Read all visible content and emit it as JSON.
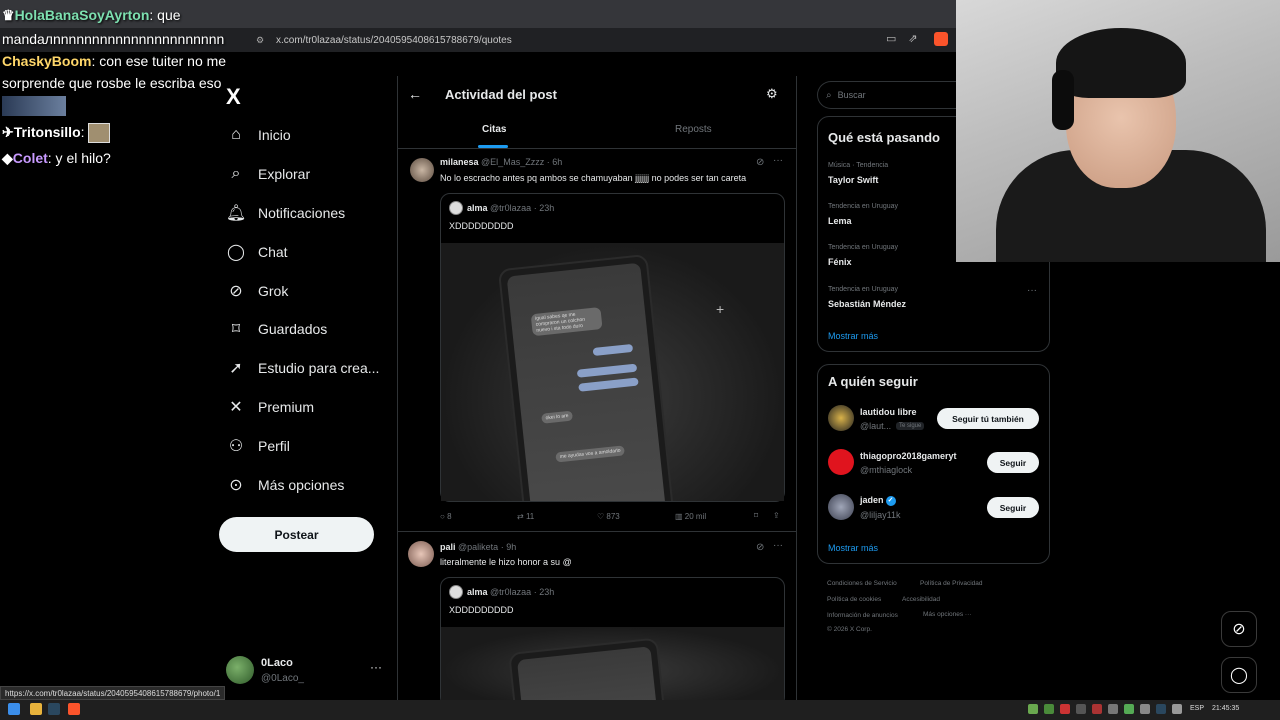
{
  "browser": {
    "url": "x.com/tr0lazaa/status/2040595408615788679/quotes",
    "status_url": "https://x.com/tr0lazaa/status/2040595408615788679/photo/1"
  },
  "chat": {
    "line1_name": "HolaBanaSoyAyrton",
    "line1_msg": ": que",
    "line2_msg": "mandaлnnnnnnnnnnnnnnnnnnnnnn",
    "line3_name": "ChaskyBoom",
    "line3_msg": ": con ese tuiter no me",
    "line4_msg": "sorprende que rosbe le escriba eso",
    "line5_name": "Tritonsillo",
    "line5_msg": ":",
    "line6_name": "Colet",
    "line6_msg": ": y el hilo?"
  },
  "nav": {
    "logo": "X",
    "items": [
      {
        "label": "Inicio",
        "icon": "home-icon",
        "glyph": "⌂"
      },
      {
        "label": "Explorar",
        "icon": "search-icon",
        "glyph": "⌕"
      },
      {
        "label": "Notificaciones",
        "icon": "bell-icon",
        "glyph": "🔔︎"
      },
      {
        "label": "Chat",
        "icon": "chat-icon",
        "glyph": "◯"
      },
      {
        "label": "Grok",
        "icon": "grok-icon",
        "glyph": "⊘"
      },
      {
        "label": "Guardados",
        "icon": "bookmark-icon",
        "glyph": "⌑"
      },
      {
        "label": "Estudio para crea...",
        "icon": "rocket-icon",
        "glyph": "➚"
      },
      {
        "label": "Premium",
        "icon": "x-premium-icon",
        "glyph": "✕"
      },
      {
        "label": "Perfil",
        "icon": "person-icon",
        "glyph": "⚇"
      },
      {
        "label": "Más opciones",
        "icon": "more-circle-icon",
        "glyph": "⊙"
      }
    ],
    "post_button": "Postear",
    "me_name": "0Laco",
    "me_handle": "@0Laco_",
    "me_more": "···"
  },
  "main": {
    "title": "Actividad del post",
    "tabs": {
      "citas": "Citas",
      "reposts": "Reposts"
    },
    "posts": [
      {
        "name": "milanesa",
        "handle": "@El_Mas_Zzzz",
        "time": "· 6h",
        "text": "No lo escracho antes pq ambos se chamuyaban jjjjjjj no podes ser tan careta",
        "quote_name": "alma",
        "quote_handle": "@tr0lazaa",
        "quote_time": "· 23h",
        "quote_text": "XDDDDDDDDD",
        "replies": "8",
        "reposts": "11",
        "likes": "873",
        "views": "20 mil"
      },
      {
        "name": "pali",
        "handle": "@paliketa",
        "time": "· 9h",
        "text": "literalmente le hizo honor a su @",
        "quote_name": "alma",
        "quote_handle": "@tr0lazaa",
        "quote_time": "· 23h",
        "quote_text": "XDDDDDDDDD"
      }
    ],
    "phone_msgs": [
      "igual sabes qe me compraron un colchon nuevo i sta todo duro",
      "okei lo are",
      "me ayudas vos a amoldarlo"
    ]
  },
  "right": {
    "search_placeholder": "Buscar",
    "trends_title": "Qué está pasando",
    "trends": [
      {
        "category": "Música · Tendencia",
        "name": "Taylor Swift"
      },
      {
        "category": "Tendencia en Uruguay",
        "name": "Lema"
      },
      {
        "category": "Tendencia en Uruguay",
        "name": "Fénix"
      },
      {
        "category": "Tendencia en Uruguay",
        "name": "Sebastián Méndez"
      }
    ],
    "trends_more": "Mostrar más",
    "follow_title": "A quién seguir",
    "follow": [
      {
        "name": "lautidou libre",
        "handle": "@laut...",
        "badge": "Te sigue",
        "button": "Seguir tú también"
      },
      {
        "name": "thiagopro2018gameryt",
        "handle": "@mthiaglock",
        "button": "Seguir"
      },
      {
        "name": "jaden",
        "handle": "@liljay11k",
        "button": "Seguir"
      }
    ],
    "follow_more": "Mostrar más",
    "footer": {
      "terms": "Condiciones de Servicio",
      "privacy": "Política de Privacidad",
      "cookies": "Política de cookies",
      "accessibility": "Accesibilidad",
      "ads": "Información de anuncios",
      "more": "Más opciones ···",
      "copyright": "© 2026 X Corp."
    }
  },
  "taskbar": {
    "lang": "ESP",
    "time": "21:45:35"
  },
  "colors": {
    "accent": "#1d9bf0",
    "background": "#000000",
    "border": "#2f3336"
  }
}
